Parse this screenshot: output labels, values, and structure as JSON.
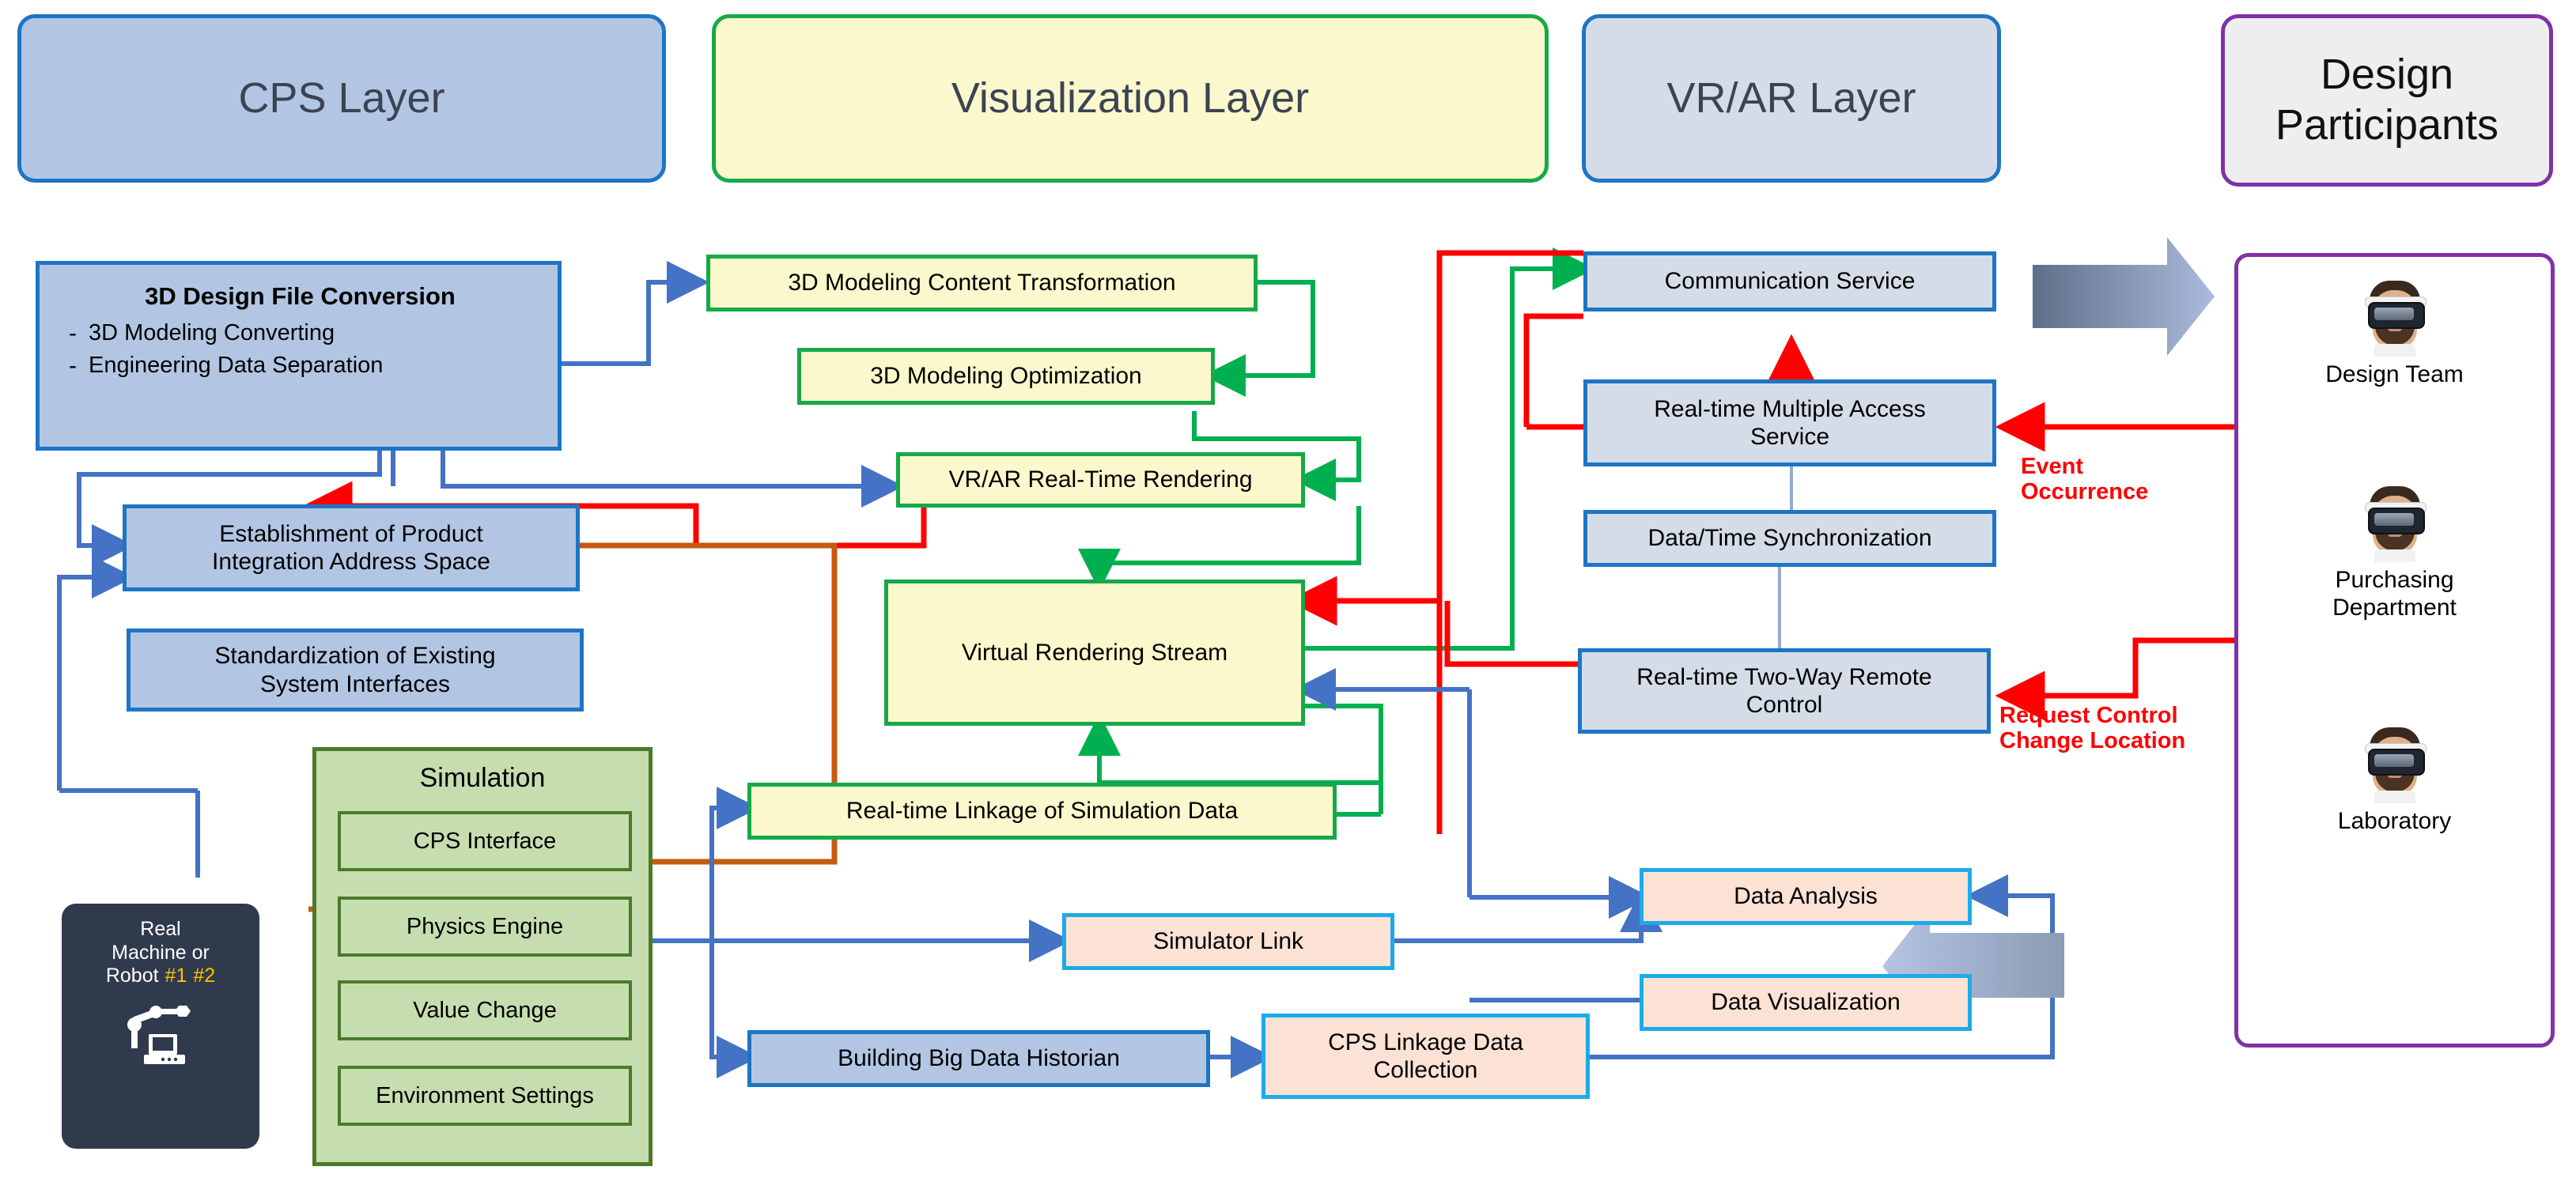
{
  "headers": {
    "cps": "CPS Layer",
    "visualization": "Visualization Layer",
    "vrar": "VR/AR Layer",
    "participants": "Design\nParticipants"
  },
  "cps_layer": {
    "conversion": {
      "title": "3D Design File Conversion",
      "bullet_marker": "-",
      "items": [
        "3D Modeling Converting",
        "Engineering Data Separation"
      ]
    },
    "address_space": "Establishment of Product\nIntegration Address Space",
    "standardization": "Standardization of Existing\nSystem Interfaces",
    "simulation": {
      "title": "Simulation",
      "items": [
        "CPS Interface",
        "Physics Engine",
        "Value Change",
        "Environment Settings"
      ]
    },
    "real_machine": {
      "line1": "Real",
      "line2": "Machine or",
      "line3_prefix": "Robot ",
      "tag1": "#1",
      "tag2": "#2",
      "icon": "robot-arm-icon"
    }
  },
  "visualization_layer": {
    "content_transformation": "3D Modeling Content Transformation",
    "optimization": "3D Modeling Optimization",
    "realtime_rendering": "VR/AR Real-Time Rendering",
    "virtual_stream": "Virtual Rendering Stream",
    "simulation_linkage": "Real-time Linkage of Simulation Data",
    "simulator_link": "Simulator Link",
    "big_data_historian": "Building Big Data Historian"
  },
  "vrar_layer": {
    "communication_service": "Communication Service",
    "multiple_access": "Real-time Multiple Access\nService",
    "data_time_sync": "Data/Time Synchronization",
    "two_way_remote": "Real-time Two-Way Remote\nControl"
  },
  "data_layer": {
    "data_analysis": "Data Analysis",
    "data_visualization": "Data Visualization",
    "cps_linkage": "CPS Linkage Data\nCollection"
  },
  "annotations": {
    "event_occurrence": "Event\nOccurrence",
    "request_control": "Request Control\nChange Location"
  },
  "participants": [
    {
      "name": "Design Team",
      "avatar": "vr-headset-avatar"
    },
    {
      "name": "Purchasing\nDepartment",
      "avatar": "vr-headset-avatar"
    },
    {
      "name": "Laboratory",
      "avatar": "vr-headset-avatar"
    }
  ],
  "colors": {
    "cps_blue": "#1d75c4",
    "cps_blue_fill": "#b2c6e4",
    "vis_green": "#16a948",
    "vis_yellow_fill": "#fbf8cd",
    "vrar_gray_fill": "#d4dce8",
    "participants_purple": "#8031a7",
    "peach_fill": "#fbe2d4",
    "peach_border": "#1cabe8",
    "sim_green_fill": "#c6ddb0",
    "sim_green_border": "#4a7a2a",
    "event_red": "#ff0000",
    "orange_wire": "#c55a11",
    "blue_wire": "#4472c4",
    "dark_navy": "#303a4d",
    "tag_amber": "#ffc000"
  }
}
